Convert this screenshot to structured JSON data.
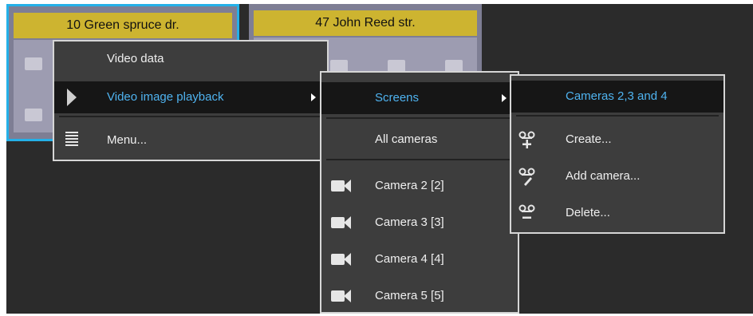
{
  "cards": [
    {
      "title": "10 Green spruce dr."
    },
    {
      "title": "47 John Reed str."
    }
  ],
  "context_menu": {
    "items": [
      {
        "label": "Video data"
      },
      {
        "label": "Video image playback"
      },
      {
        "label": "Menu..."
      }
    ]
  },
  "playback_menu": {
    "items": [
      {
        "label": "Screens"
      },
      {
        "label": "All cameras"
      },
      {
        "label": "Camera 2 [2]"
      },
      {
        "label": "Camera 3 [3]"
      },
      {
        "label": "Camera 4 [4]"
      },
      {
        "label": "Camera 5 [5]"
      }
    ]
  },
  "screens_menu": {
    "items": [
      {
        "label": "Cameras 2,3 and 4"
      },
      {
        "label": "Create..."
      },
      {
        "label": "Add camera..."
      },
      {
        "label": "Delete..."
      }
    ]
  },
  "colors": {
    "highlight_text": "#4fb3f0",
    "selection_border": "#24b0e8",
    "card_title_bg": "#cdb430"
  }
}
